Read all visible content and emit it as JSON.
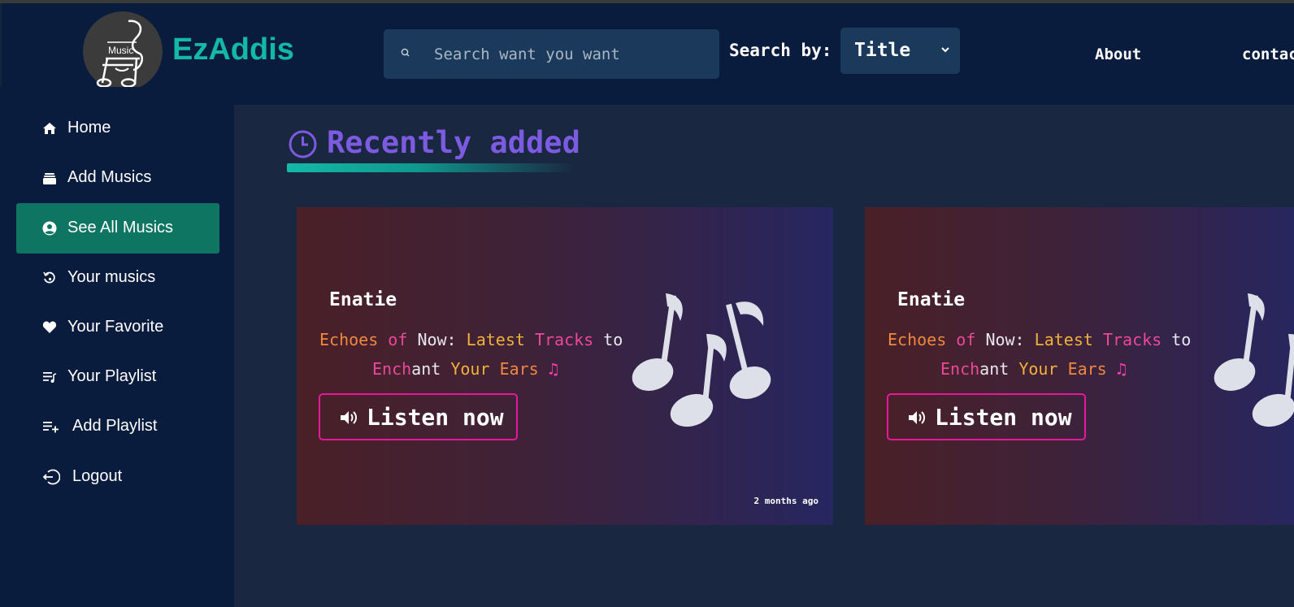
{
  "header": {
    "brand": "EzAddis",
    "logo_text": "Music",
    "search": {
      "placeholder": "Search want you want",
      "value": ""
    },
    "search_by": {
      "label": "Search by:",
      "selected": "Title"
    },
    "nav": {
      "about": "About",
      "contact": "contac"
    }
  },
  "sidebar": {
    "items": [
      {
        "label": "Home",
        "icon": "home-icon",
        "active": false
      },
      {
        "label": "Add Musics",
        "icon": "album-stack-icon",
        "active": false
      },
      {
        "label": "See All Musics",
        "icon": "user-circle-icon",
        "active": true
      },
      {
        "label": "Your musics",
        "icon": "history-icon",
        "active": false
      },
      {
        "label": "Your Favorite",
        "icon": "heart-icon",
        "active": false
      },
      {
        "label": "Your Playlist",
        "icon": "playlist-icon",
        "active": false
      },
      {
        "label": "Add Playlist",
        "icon": "playlist-add-icon",
        "active": false
      },
      {
        "label": "Logout",
        "icon": "logout-icon",
        "active": false
      }
    ]
  },
  "main": {
    "section_title": "Recently added",
    "cards": [
      {
        "title": "Enatie",
        "tagline": {
          "w1": "Echoes",
          "w2": "of",
          "w3": "Now:",
          "w4": "Latest",
          "w5": "Tracks",
          "w6": "to",
          "w7a": "Ench",
          "w7b": "ant",
          "w8": "Your",
          "w9": "Ears",
          "note": "♫"
        },
        "button": "Listen now",
        "time": "2 months ago"
      },
      {
        "title": "Enatie",
        "tagline": {
          "w1": "Echoes",
          "w2": "of",
          "w3": "Now:",
          "w4": "Latest",
          "w5": "Tracks",
          "w6": "to",
          "w7a": "Ench",
          "w7b": "ant",
          "w8": "Your",
          "w9": "Ears",
          "note": "♫"
        },
        "button": "Listen now"
      }
    ]
  },
  "colors": {
    "accent_teal": "#14b8a6",
    "active_item": "#0f7563",
    "title_purple": "#7c5be0",
    "button_border": "#e5199a"
  }
}
